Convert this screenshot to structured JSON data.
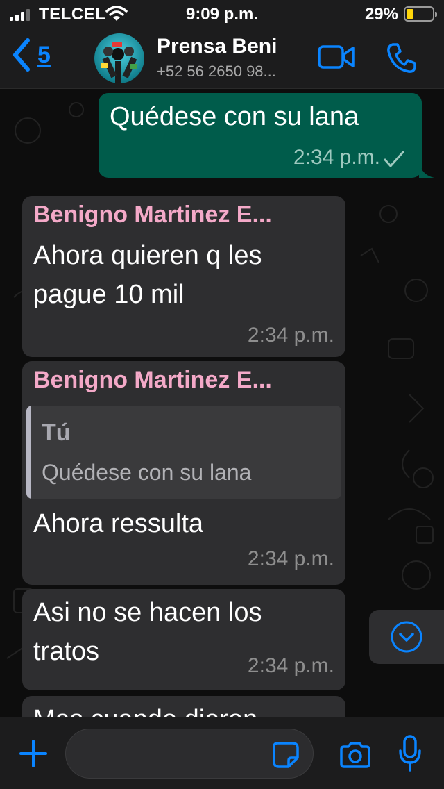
{
  "status_bar": {
    "carrier": "TELCEL",
    "time": "9:09 p.m.",
    "battery_percent_label": "29%",
    "battery_level": 0.29
  },
  "header": {
    "back_count": "5",
    "contact_name": "Prensa Beni",
    "contact_phone": "+52 56 2650 98..."
  },
  "messages": [
    {
      "direction": "outgoing",
      "text": "Quédese con su lana",
      "time": "2:34 p.m.",
      "status": "sent"
    },
    {
      "direction": "incoming",
      "sender": "Benigno Martinez E...",
      "text_lines": [
        "Ahora quieren q les",
        "pague 10 mil"
      ],
      "time": "2:34 p.m."
    },
    {
      "direction": "incoming",
      "sender": "Benigno Martinez E...",
      "quote": {
        "author": "Tú",
        "text": "Quédese con su lana"
      },
      "text": "Ahora ressulta",
      "time": "2:34 p.m."
    },
    {
      "direction": "incoming",
      "text_lines": [
        "Asi no se hacen los",
        "tratos"
      ],
      "time": "2:34 p.m."
    },
    {
      "direction": "incoming",
      "text": "Mas cuando dieron",
      "partial": true
    }
  ],
  "icons": {
    "back": "chevron-left-icon",
    "video": "video-camera-icon",
    "call": "phone-icon",
    "scroll_down": "chevron-down-circle-icon",
    "attach": "plus-icon",
    "sticker": "sticker-icon",
    "camera": "camera-icon",
    "mic": "microphone-icon"
  },
  "colors": {
    "accent": "#0a84ff",
    "outgoing_bubble": "#005c4b",
    "incoming_bubble": "#2e2e30",
    "sender_name": "#f4a9c8"
  }
}
